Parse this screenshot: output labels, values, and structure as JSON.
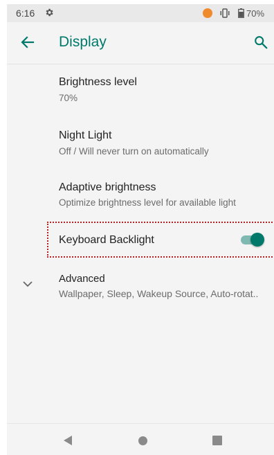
{
  "status_bar": {
    "time": "6:16",
    "battery_percent": "70%",
    "icons": [
      "gear-icon",
      "notification-dot-icon",
      "vibrate-icon",
      "battery-icon"
    ],
    "notification_color": "#ef8a2d"
  },
  "toolbar": {
    "title": "Display",
    "back_icon": "arrow-back-icon",
    "search_icon": "search-icon",
    "accent_color": "#00796b"
  },
  "settings": [
    {
      "title": "Brightness level",
      "subtitle": "70%"
    },
    {
      "title": "Night Light",
      "subtitle": "Off / Will never turn on automatically"
    },
    {
      "title": "Adaptive brightness",
      "subtitle": "Optimize brightness level for available light"
    },
    {
      "title": "Keyboard Backlight",
      "toggle_on": true
    },
    {
      "title": "Advanced",
      "subtitle": "Wallpaper, Sleep, Wakeup Source, Auto-rotat.."
    }
  ],
  "nav_bar": {
    "icons": [
      "back-triangle-icon",
      "home-circle-icon",
      "recents-square-icon"
    ]
  }
}
